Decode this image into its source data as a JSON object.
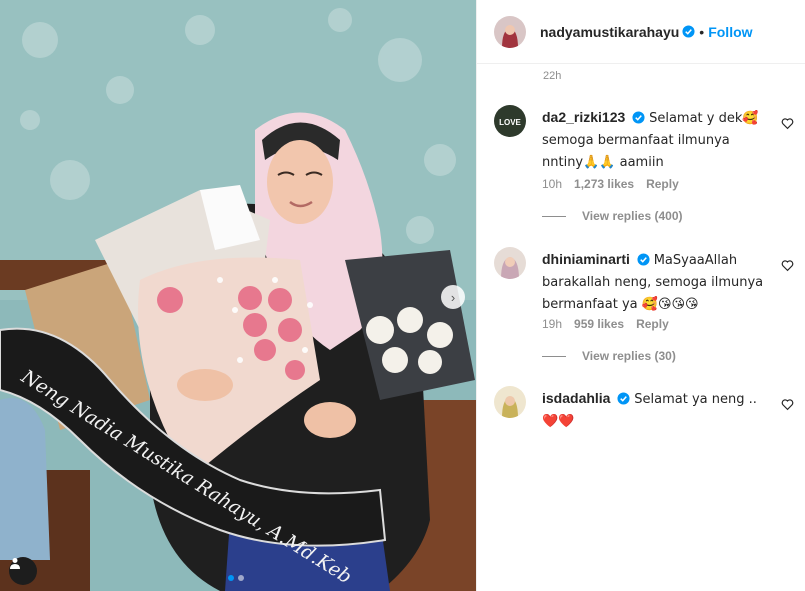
{
  "photo": {
    "sash_text": "Neng Nadia Mustika Rahayu, A.Md.Keb",
    "slide_count": 2,
    "active_slide": 1
  },
  "post": {
    "username": "nadyamustikarahayu",
    "follow_label": "Follow",
    "bullet": "•",
    "post_time": "22h"
  },
  "comments": [
    {
      "username": "da2_rizki123",
      "verified": true,
      "text": "Selamat y dek🥰 semoga bermanfaat ilmunya nntiny🙏🙏 aamiin",
      "time": "10h",
      "likes": "1,273 likes",
      "reply": "Reply",
      "view_replies": "View replies (400)",
      "avatar_text": "LOVE"
    },
    {
      "username": "dhiniaminarti",
      "verified": true,
      "text": "MaSyaaAllah barakallah neng, semoga ilmunya bermanfaat ya 🥰😘😘😘",
      "time": "19h",
      "likes": "959 likes",
      "reply": "Reply",
      "view_replies": "View replies (30)"
    },
    {
      "username": "isdadahlia",
      "verified": true,
      "text": "Selamat ya neng .. ❤️❤️"
    }
  ],
  "icons": {
    "verified": "verified-badge-icon",
    "heart": "heart-outline-icon",
    "next": "chevron-right-icon",
    "tag": "user-tag-icon"
  },
  "colors": {
    "accent": "#0095f6",
    "muted": "#8e8e8e",
    "text": "#262626"
  }
}
